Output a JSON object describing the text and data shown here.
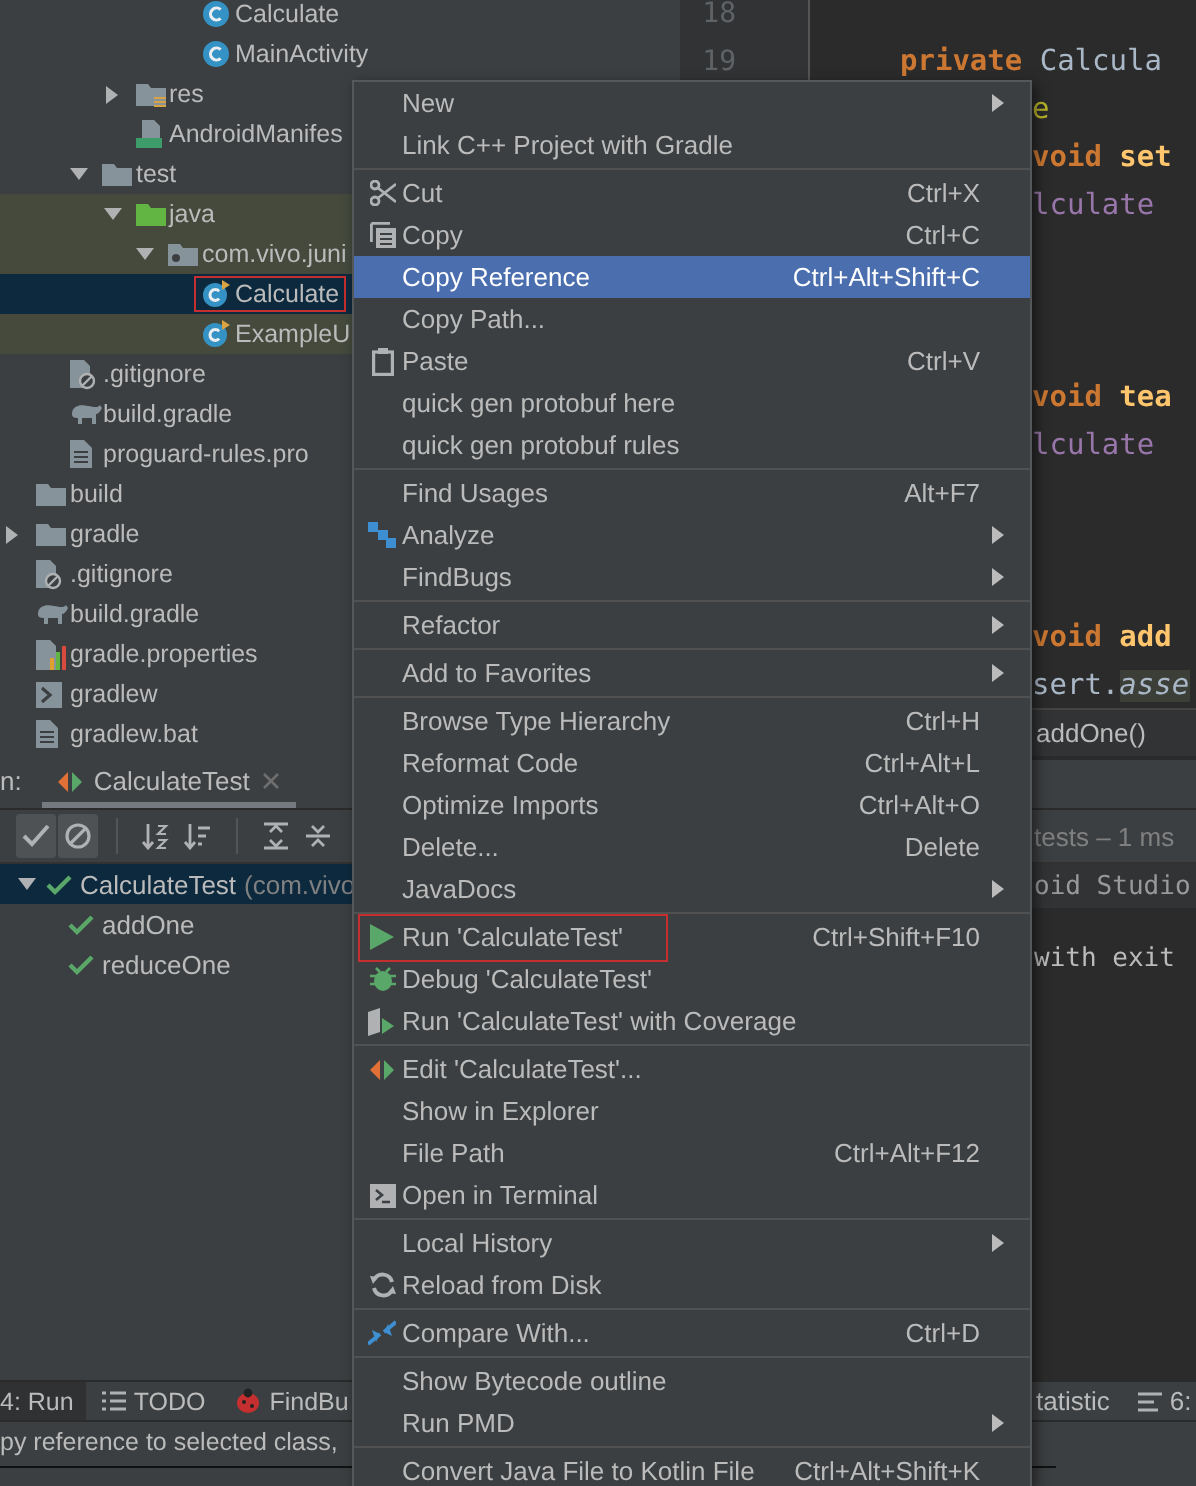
{
  "project_tree": [
    {
      "children": [
        {
          "children": [
            {
              "children": [
                {
                  "children": [
                    {
                      "children": [
                        {
                          "label": "Calculate",
                          "kind": "class",
                          "selected": false
                        },
                        {
                          "label": "MainActivity",
                          "kind": "class",
                          "selected": false
                        }
                      ]
                    }
                  ]
                },
                {
                  "label": "res",
                  "kind": "resources",
                  "expanded": false,
                  "selected": false
                },
                {
                  "label": "AndroidManifes",
                  "kind": "manifest",
                  "selected": false
                }
              ]
            },
            {
              "label": "test",
              "kind": "folder",
              "expanded": true,
              "selected": false,
              "children": [
                {
                  "label": "java",
                  "kind": "source-folder",
                  "expanded": true,
                  "selected": false,
                  "tinted": true,
                  "children": [
                    {
                      "label": "com.vivo.juni",
                      "kind": "package",
                      "expanded": true,
                      "selected": false,
                      "tinted": true,
                      "children": [
                        {
                          "label": "Calculate",
                          "kind": "test-class",
                          "selected": true,
                          "tinted": true,
                          "annotated": true
                        },
                        {
                          "label": "ExampleU",
                          "kind": "test-class",
                          "selected": false,
                          "tinted": true
                        }
                      ]
                    }
                  ]
                }
              ]
            }
          ]
        },
        {
          "label": ".gitignore",
          "kind": "ignore-file",
          "selected": false
        },
        {
          "label": "build.gradle",
          "kind": "gradle",
          "selected": false
        },
        {
          "label": "proguard-rules.pro",
          "kind": "file",
          "selected": false
        }
      ]
    },
    {
      "label": "build",
      "kind": "folder",
      "selected": false
    },
    {
      "label": "gradle",
      "kind": "folder",
      "expanded": false,
      "selected": false
    },
    {
      "label": ".gitignore",
      "kind": "ignore-file",
      "selected": false
    },
    {
      "label": "build.gradle",
      "kind": "gradle",
      "selected": false
    },
    {
      "label": "gradle.properties",
      "kind": "properties",
      "selected": false
    },
    {
      "label": "gradlew",
      "kind": "script",
      "selected": false
    },
    {
      "label": "gradlew.bat",
      "kind": "file",
      "selected": false
    }
  ],
  "editor": {
    "lines": [
      {
        "number": "18",
        "kind": "blank"
      },
      {
        "number": "19",
        "kind": "code",
        "tokens": [
          {
            "text": "private ",
            "kind": "keyword"
          },
          {
            "text": "Calcula",
            "kind": "plain"
          }
        ]
      },
      {
        "kind": "code",
        "tokens": [
          {
            "text": "e",
            "kind": "annotation"
          }
        ]
      },
      {
        "kind": "code",
        "tokens": [
          {
            "text": "void ",
            "kind": "keyword"
          },
          {
            "text": "set",
            "kind": "declaration"
          }
        ]
      },
      {
        "kind": "code",
        "tokens": [
          {
            "text": "lculate",
            "kind": "field"
          }
        ]
      },
      {
        "kind": "blank"
      },
      {
        "kind": "blank"
      },
      {
        "kind": "blank"
      },
      {
        "kind": "code",
        "tokens": [
          {
            "text": "void ",
            "kind": "keyword"
          },
          {
            "text": "tea",
            "kind": "declaration"
          }
        ]
      },
      {
        "kind": "code",
        "tokens": [
          {
            "text": "lculate",
            "kind": "field"
          }
        ]
      },
      {
        "kind": "blank"
      },
      {
        "kind": "blank"
      },
      {
        "kind": "blank"
      },
      {
        "kind": "code",
        "tokens": [
          {
            "text": "void ",
            "kind": "keyword"
          },
          {
            "text": "add",
            "kind": "declaration"
          }
        ]
      },
      {
        "kind": "code",
        "tokens": [
          {
            "text": "sert.",
            "kind": "plain"
          },
          {
            "text": "asse",
            "kind": "highlighted-call"
          }
        ]
      }
    ],
    "breadcrumb": "addOne()"
  },
  "context_menu": [
    {
      "kind": "item",
      "label": "New",
      "submenu": true,
      "selected": false
    },
    {
      "kind": "item",
      "label": "Link C++ Project with Gradle",
      "selected": false
    },
    {
      "kind": "separator"
    },
    {
      "kind": "item",
      "label": "Cut",
      "shortcut": "Ctrl+X",
      "selected": false
    },
    {
      "kind": "item",
      "label": "Copy",
      "shortcut": "Ctrl+C",
      "selected": false
    },
    {
      "kind": "item",
      "label": "Copy Reference",
      "shortcut": "Ctrl+Alt+Shift+C",
      "selected": true
    },
    {
      "kind": "item",
      "label": "Copy Path...",
      "selected": false
    },
    {
      "kind": "item",
      "label": "Paste",
      "shortcut": "Ctrl+V",
      "selected": false
    },
    {
      "kind": "item",
      "label": "quick gen protobuf here",
      "selected": false
    },
    {
      "kind": "item",
      "label": "quick gen protobuf rules",
      "selected": false
    },
    {
      "kind": "separator"
    },
    {
      "kind": "item",
      "label": "Find Usages",
      "shortcut": "Alt+F7",
      "selected": false
    },
    {
      "kind": "item",
      "label": "Analyze",
      "submenu": true,
      "selected": false
    },
    {
      "kind": "item",
      "label": "FindBugs",
      "submenu": true,
      "selected": false
    },
    {
      "kind": "separator"
    },
    {
      "kind": "item",
      "label": "Refactor",
      "submenu": true,
      "selected": false
    },
    {
      "kind": "separator"
    },
    {
      "kind": "item",
      "label": "Add to Favorites",
      "submenu": true,
      "selected": false
    },
    {
      "kind": "separator"
    },
    {
      "kind": "item",
      "label": "Browse Type Hierarchy",
      "shortcut": "Ctrl+H",
      "selected": false
    },
    {
      "kind": "item",
      "label": "Reformat Code",
      "shortcut": "Ctrl+Alt+L",
      "selected": false
    },
    {
      "kind": "item",
      "label": "Optimize Imports",
      "shortcut": "Ctrl+Alt+O",
      "selected": false
    },
    {
      "kind": "item",
      "label": "Delete...",
      "shortcut": "Delete",
      "selected": false
    },
    {
      "kind": "item",
      "label": "JavaDocs",
      "submenu": true,
      "selected": false
    },
    {
      "kind": "separator"
    },
    {
      "kind": "item",
      "label": "Run 'CalculateTest'",
      "shortcut": "Ctrl+Shift+F10",
      "selected": false,
      "annotated": true
    },
    {
      "kind": "item",
      "label": "Debug 'CalculateTest'",
      "selected": false
    },
    {
      "kind": "item",
      "label": "Run 'CalculateTest' with Coverage",
      "selected": false
    },
    {
      "kind": "separator"
    },
    {
      "kind": "item",
      "label": "Edit 'CalculateTest'...",
      "selected": false
    },
    {
      "kind": "item",
      "label": "Show in Explorer",
      "selected": false
    },
    {
      "kind": "item",
      "label": "File Path",
      "shortcut": "Ctrl+Alt+F12",
      "selected": false
    },
    {
      "kind": "item",
      "label": "Open in Terminal",
      "selected": false
    },
    {
      "kind": "separator"
    },
    {
      "kind": "item",
      "label": "Local History",
      "submenu": true,
      "selected": false
    },
    {
      "kind": "item",
      "label": "Reload from Disk",
      "selected": false
    },
    {
      "kind": "separator"
    },
    {
      "kind": "item",
      "label": "Compare With...",
      "shortcut": "Ctrl+D",
      "selected": false
    },
    {
      "kind": "separator"
    },
    {
      "kind": "item",
      "label": "Show Bytecode outline",
      "selected": false
    },
    {
      "kind": "item",
      "label": "Run PMD",
      "submenu": true,
      "selected": false
    },
    {
      "kind": "separator"
    },
    {
      "kind": "item",
      "label": "Convert Java File to Kotlin File",
      "shortcut": "Ctrl+Alt+Shift+K",
      "selected": false
    }
  ],
  "run_panel": {
    "label": "n:",
    "tab": {
      "label": "CalculateTest",
      "selected": true
    },
    "toolbar": [
      {
        "selected": true
      },
      {
        "selected": true
      },
      {
        "selected": false
      },
      {
        "selected": false
      },
      {
        "selected": false
      },
      {
        "selected": false
      }
    ],
    "status": "tests – 1 ms",
    "test_tree": [
      {
        "label": "CalculateTest",
        "detail": "(com.vivo",
        "passed": true,
        "expanded": true,
        "selected": true,
        "children": [
          {
            "label": "addOne",
            "passed": true,
            "selected": false
          },
          {
            "label": "reduceOne",
            "passed": true,
            "selected": false
          }
        ]
      }
    ],
    "console": [
      {
        "kind": "command",
        "text": "oid Studio"
      },
      {
        "kind": "blank"
      },
      {
        "kind": "output",
        "text": "with exit"
      }
    ]
  },
  "tool_tabs": [
    {
      "label": "4: Run",
      "selected": true
    },
    {
      "label": "TODO",
      "selected": false
    },
    {
      "label": "FindBu",
      "selected": false
    }
  ],
  "right_tool_tabs": [
    {
      "label": "tatistic",
      "selected": false
    },
    {
      "label": "6:",
      "selected": false
    }
  ],
  "status_bar": {
    "text": "py reference to selected class,"
  }
}
